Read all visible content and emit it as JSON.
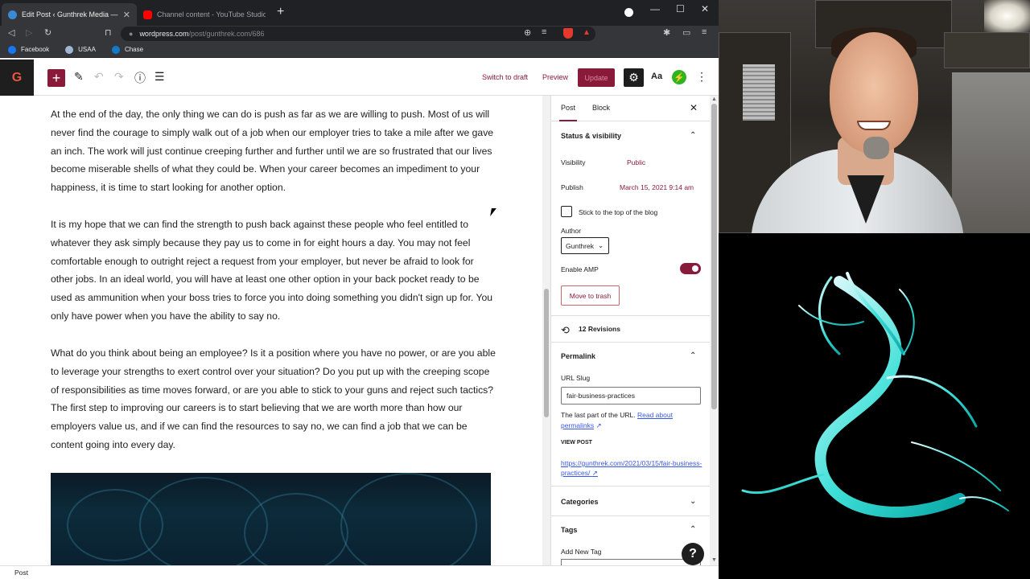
{
  "browser": {
    "tabs": [
      {
        "title": "Edit Post ‹ Gunthrek Media — W",
        "active": true,
        "favicon_color": "#3a8ad4"
      },
      {
        "title": "Channel content - YouTube Studio",
        "active": false,
        "favicon_color": "#ff0000"
      }
    ],
    "url": {
      "domain": "wordpress.com",
      "path": "/post/gunthrek.com/686"
    },
    "bookmarks": [
      {
        "label": "Facebook",
        "icon_color": "#1877f2"
      },
      {
        "label": "USAA",
        "icon_color": "#9fb7d3"
      },
      {
        "label": "Chase",
        "icon_color": "#117aca"
      }
    ]
  },
  "editor": {
    "logo_letter": "G",
    "toolbar": {
      "switch_to_draft": "Switch to draft",
      "preview": "Preview",
      "update": "Update",
      "typography": "Aa"
    },
    "paragraphs": [
      "At the end of the day, the only thing we can do is push as far as we are willing to push.  Most of us will never find the courage to simply walk out of a job when our employer tries to take a mile after we gave an inch.  The work will just continue creeping further and further until we are so frustrated that our lives become miserable shells of what they could be.  When your career becomes an impediment to your happiness, it is time to start looking for another option.",
      "It is my hope that we can find the strength to push back against these people who feel entitled to whatever they ask simply because they pay us to come in for eight hours a day.  You may not feel comfortable enough to outright reject a request from your employer, but never be afraid to look for other jobs.  In an ideal world, you will have at least one other option in your back pocket ready to be used as ammunition when your boss tries to force you into doing something you didn't sign up for.  You only have power when you have the ability to say no.",
      "What do you think about being an employee?  Is it a position where you have no power, or are you able to leverage your strengths to exert control over your situation?  Do you put up with the creeping scope of responsibilities as time moves forward, or are you able to stick to your guns and reject such tactics?  The first step to improving our careers is to start believing that we are worth more than how our employers value us, and if we can find the resources to say no, we can find a job that we can be content going into every day."
    ],
    "statusbar": "Post"
  },
  "sidebar": {
    "tabs": [
      "Post",
      "Block"
    ],
    "status_visibility": {
      "heading": "Status & visibility",
      "visibility_label": "Visibility",
      "visibility_value": "Public",
      "publish_label": "Publish",
      "publish_value": "March 15, 2021 9:14 am",
      "sticky_label": "Stick to the top of the blog",
      "author_label": "Author",
      "author_value": "Gunthrek",
      "amp_label": "Enable AMP",
      "amp_enabled": true,
      "trash_label": "Move to trash"
    },
    "revisions": "12 Revisions",
    "permalink": {
      "heading": "Permalink",
      "slug_label": "URL Slug",
      "slug_value": "fair-business-practices",
      "help_text": "The last part of the URL.",
      "help_link": "Read about permalinks",
      "view_post_label": "VIEW POST",
      "view_post_url": "https://gunthrek.com/2021/03/15/fair-business-practices/"
    },
    "categories_heading": "Categories",
    "tags": {
      "heading": "Tags",
      "add_label": "Add New Tag"
    },
    "help_fab": "?"
  },
  "colors": {
    "accent": "#8a1a3a",
    "link": "#3858e9",
    "jetpack": "#2fb41f"
  }
}
